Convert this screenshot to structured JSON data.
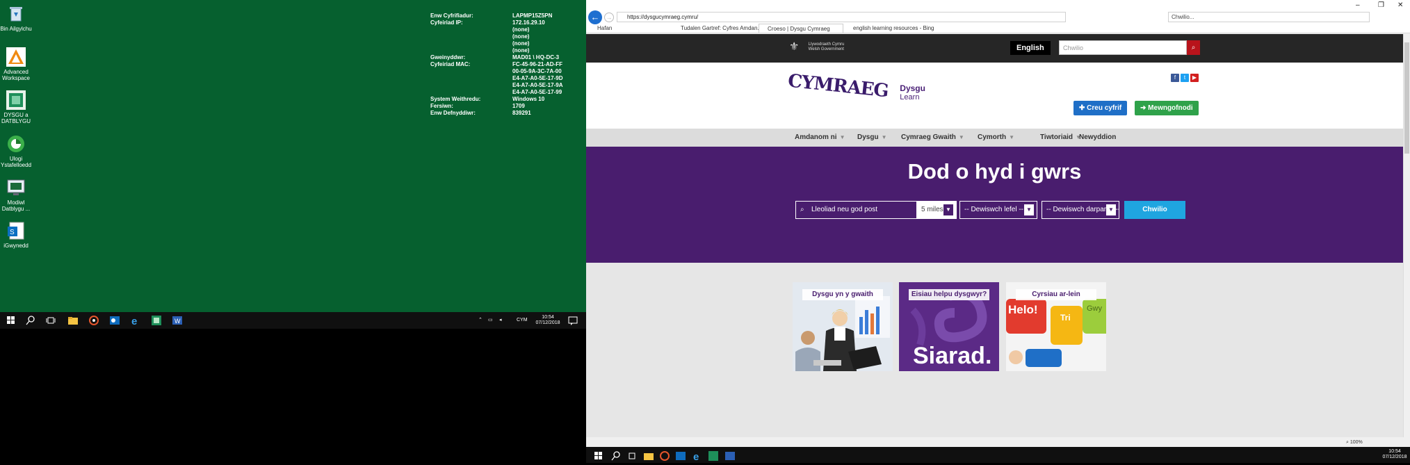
{
  "desktop": {
    "icons": [
      {
        "label": "Bin Ailgylchu",
        "icon": "recycle-bin-icon"
      },
      {
        "label": "Advanced Workspace",
        "icon": "workspace-icon"
      },
      {
        "label": "DYSGU a DATBLYGU",
        "icon": "app-icon"
      },
      {
        "label": "Ulogi Ystafelloedd",
        "icon": "app-icon"
      },
      {
        "label": "Modiwl Datblygu ...",
        "icon": "app-icon"
      },
      {
        "label": "iGwynedd",
        "icon": "sharepoint-icon"
      }
    ],
    "sysinfo": [
      {
        "k": "Enw Cyfrifiadur:",
        "v": "LAPMP15Z5PN"
      },
      {
        "k": "Cyfeiriad IP:",
        "v": "172.16.29.10"
      },
      {
        "k": "",
        "v": "(none)"
      },
      {
        "k": "",
        "v": "(none)"
      },
      {
        "k": "",
        "v": "(none)"
      },
      {
        "k": "",
        "v": "(none)"
      },
      {
        "k": "Gweinyddwr:",
        "v": "MAD01 \\ HQ-DC-3"
      },
      {
        "k": "Cyfeiriad MAC:",
        "v": "FC-45-96-21-AD-FF"
      },
      {
        "k": "",
        "v": "00-05-9A-3C-7A-00"
      },
      {
        "k": "",
        "v": "E4-A7-A0-5E-17-9D"
      },
      {
        "k": "",
        "v": "E4-A7-A0-5E-17-9A"
      },
      {
        "k": "",
        "v": "E4-A7-A0-5E-17-99"
      },
      {
        "k": "System Weithredu:",
        "v": "Windows 10"
      },
      {
        "k": "Fersiwn:",
        "v": "1709"
      },
      {
        "k": "Enw Defnyddiwr:",
        "v": "839291"
      }
    ]
  },
  "taskbar_left": {
    "lang": "CYM",
    "time": "10:54",
    "date": "07/12/2018"
  },
  "taskbar_right": {
    "time": "10:54",
    "date": "07/12/2018"
  },
  "browser": {
    "url": "https://dysgucymraeg.cymru/",
    "search_placeholder": "Chwilio...",
    "tabs": [
      "Hafan",
      "Tudalen Gartref: Cyfres Amdan...",
      "Croeso | Dysgu Cymraeg",
      "english learning resources - Bing"
    ],
    "zoom": "100%"
  },
  "site": {
    "gov_line1": "Llywodraeth Cymru",
    "gov_line2": "Welsh Government",
    "english_label": "English",
    "search_placeholder": "Chwilio",
    "logo_text": "CYMRAEG",
    "logo_dysgu": "Dysgu",
    "logo_learn": "Learn",
    "create_account": "Creu cyfrif",
    "login": "Mewngofnodi",
    "nav": [
      "Amdanom ni",
      "Dysgu",
      "Cymraeg Gwaith",
      "Cymorth",
      "Tiwtoriaid",
      "Newyddion"
    ],
    "hero_title": "Dod o hyd i gwrs",
    "location_placeholder": "Lleoliad neu god post",
    "distance": "5 miles",
    "level": "-- Dewiswch lefel --",
    "provider": "-- Dewiswch darparwr --",
    "find_button": "Chwilio",
    "cards": [
      "Dysgu yn y gwaith",
      "Eisiau helpu dysgwyr?",
      "Cyrsiau ar-lein"
    ],
    "card2_big": "Siarad.",
    "card3_words": [
      "Helo!",
      "Tri",
      "Gwy"
    ]
  },
  "colors": {
    "desktop": "#06602f",
    "purple": "#491d6e",
    "blue": "#1f6fc7",
    "green": "#2fa24a",
    "cyan": "#1fa5e0"
  }
}
